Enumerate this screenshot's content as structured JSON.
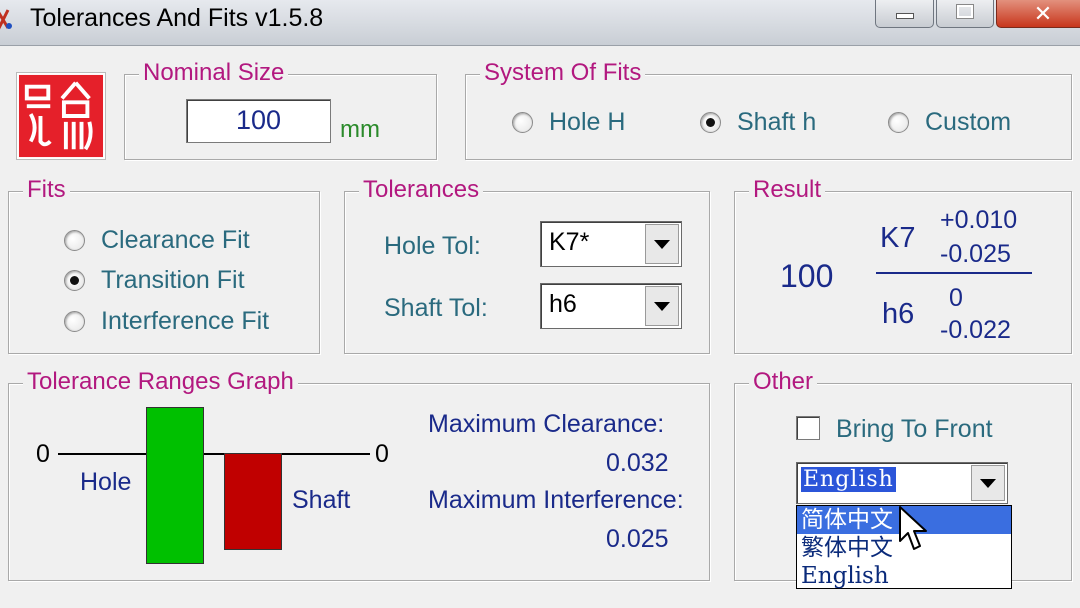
{
  "window": {
    "title": "Tolerances And Fits  v1.5.8",
    "minimize_icon": "minimize-icon",
    "maximize_icon": "maximize-icon",
    "close_icon": "close-icon",
    "close_symbol": "✕"
  },
  "logo": {
    "icon": "red-seal-logo-icon"
  },
  "nominal_size": {
    "legend": "Nominal Size",
    "value": "100",
    "unit": "mm"
  },
  "system_of_fits": {
    "legend": "System Of Fits",
    "options": [
      {
        "label": "Hole H",
        "selected": false
      },
      {
        "label": "Shaft h",
        "selected": true
      },
      {
        "label": "Custom",
        "selected": false
      }
    ]
  },
  "fits": {
    "legend": "Fits",
    "options": [
      {
        "label": "Clearance Fit",
        "selected": false
      },
      {
        "label": "Transition Fit",
        "selected": true
      },
      {
        "label": "Interference Fit",
        "selected": false
      }
    ]
  },
  "tolerances": {
    "legend": "Tolerances",
    "hole_label": "Hole Tol:",
    "hole_value": "K7*",
    "shaft_label": "Shaft Tol:",
    "shaft_value": "h6"
  },
  "result": {
    "legend": "Result",
    "size": "100",
    "hole_code": "K7",
    "hole_upper": "+0.010",
    "hole_lower": "-0.025",
    "shaft_code": "h6",
    "shaft_upper": "0",
    "shaft_lower": "-0.022"
  },
  "graph": {
    "legend": "Tolerance Ranges Graph",
    "zero_left": "0",
    "zero_right": "0",
    "hole_label": "Hole",
    "shaft_label": "Shaft",
    "hole_color": "#00c000",
    "shaft_color": "#c00000",
    "max_clearance_label": "Maximum Clearance:",
    "max_clearance_value": "0.032",
    "max_interference_label": "Maximum Interference:",
    "max_interference_value": "0.025"
  },
  "other": {
    "legend": "Other",
    "bring_to_front_label": "Bring To Front",
    "bring_to_front_checked": false,
    "language_value": "English",
    "language_options": [
      "简体中文",
      "繁体中文",
      "English"
    ],
    "highlighted_option": "简体中文"
  },
  "colors": {
    "legend_text": "#b2187f",
    "label_text": "#2a6a7e",
    "value_text": "#1a2a8a",
    "unit_text": "#2a8a2a"
  }
}
